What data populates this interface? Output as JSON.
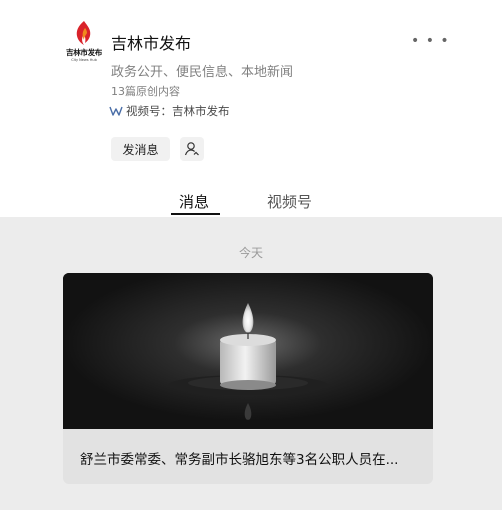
{
  "account": {
    "name": "吉林市发布",
    "logo_text": "吉林市发布",
    "logo_subtext": "City News Hub",
    "description": "政务公开、便民信息、本地新闻",
    "original_count": "13篇原创内容",
    "channel": "视频号：吉林市发布"
  },
  "actions": {
    "send_message": "发消息"
  },
  "tabs": [
    {
      "label": "消息",
      "active": true
    },
    {
      "label": "视频号",
      "active": false
    }
  ],
  "feed": {
    "date_label": "今天",
    "articles": [
      {
        "title": "舒兰市委常委、常务副市长骆旭东等3名公职人员在...",
        "image": "candle-photo"
      }
    ]
  },
  "colors": {
    "feed_background": "#ececec",
    "button_background": "#f1f1f1",
    "logo_red": "#d9232a",
    "logo_orange": "#f08a1d"
  },
  "icons": [
    "logo-flame-icon",
    "more-icon",
    "channel-icon",
    "user-icon",
    "candle-image"
  ]
}
